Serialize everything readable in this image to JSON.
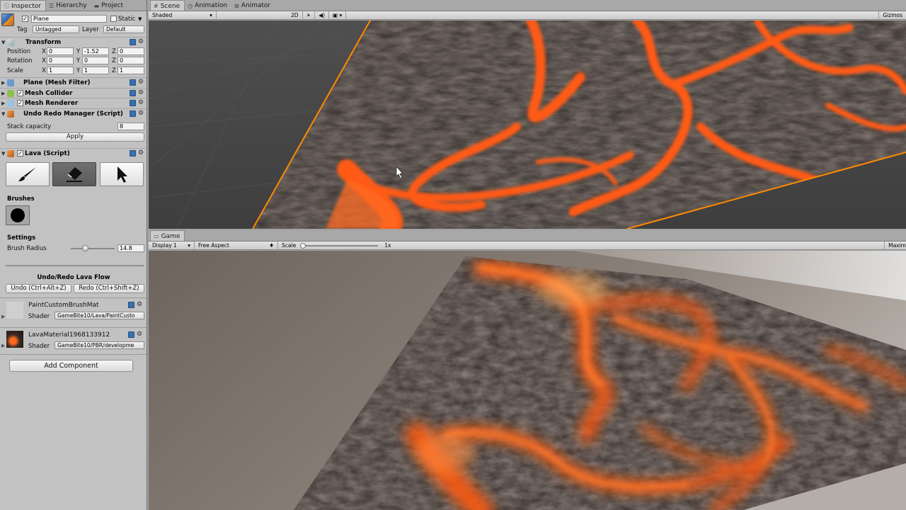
{
  "inspector": {
    "tabs": [
      "Inspector",
      "Hierarchy",
      "Project"
    ],
    "object": {
      "name": "Plane",
      "static_label": "Static",
      "tag_label": "Tag",
      "tag_value": "Untagged",
      "layer_label": "Layer",
      "layer_value": "Default",
      "active": true
    },
    "transform": {
      "title": "Transform",
      "rows": [
        {
          "label": "Position",
          "x": "0",
          "y": "-1.52",
          "z": "0"
        },
        {
          "label": "Rotation",
          "x": "0",
          "y": "0",
          "z": "0"
        },
        {
          "label": "Scale",
          "x": "1",
          "y": "1",
          "z": "1"
        }
      ]
    },
    "components": {
      "mesh_filter": "Plane (Mesh Filter)",
      "mesh_collider": "Mesh Collider",
      "mesh_renderer": "Mesh Renderer",
      "undo_manager": "Undo Redo Manager (Script)"
    },
    "undo_manager": {
      "stack_label": "Stack capacity",
      "stack_value": "8",
      "apply_label": "Apply"
    },
    "lava": {
      "title": "Lava (Script)",
      "brushes_label": "Brushes",
      "settings_label": "Settings",
      "radius_label": "Brush Radius",
      "radius_value": "14.8",
      "radius_fraction": 0.33,
      "flow_title": "Undo/Redo Lava Flow",
      "undo_label": "Undo (Ctrl+Alt+Z)",
      "redo_label": "Redo (Ctrl+Shift+Z)"
    },
    "materials": [
      {
        "name": "PaintCustomBrushMat",
        "shader_label": "Shader",
        "shader": "GameBite10/Lava/PaintCusto"
      },
      {
        "name": "LavaMaterial1968133912",
        "shader_label": "Shader",
        "shader": "GameBite10/PBR/developme"
      }
    ],
    "add_component": "Add Component"
  },
  "scene": {
    "tabs": [
      "Scene",
      "Animation",
      "Animator"
    ],
    "shading": "Shaded",
    "mode_2d": "2D",
    "gizmos": "Gizmos"
  },
  "game": {
    "tab": "Game",
    "display": "Display 1",
    "aspect": "Free Aspect",
    "scale_label": "Scale",
    "scale_value": "1x",
    "maximize": "Maxim"
  },
  "colors": {
    "accent_orange": "#ff8a00",
    "lava": "#ff5a10",
    "rock": "#3a3330",
    "panel": "#c2c2c2"
  }
}
